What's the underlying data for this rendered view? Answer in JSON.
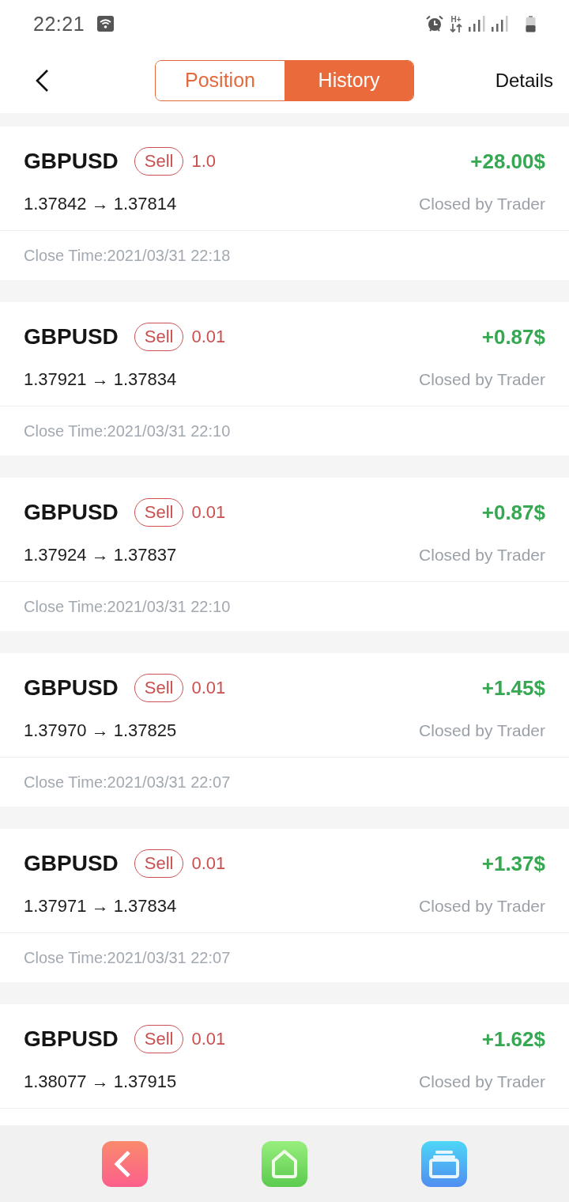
{
  "status_bar": {
    "time": "22:21",
    "network_type": "H+"
  },
  "header": {
    "tabs": [
      {
        "label": "Position",
        "selected": false
      },
      {
        "label": "History",
        "selected": true
      }
    ],
    "details": "Details"
  },
  "trades": [
    {
      "symbol": "GBPUSD",
      "side": "Sell",
      "volume": "1.0",
      "profit": "+28.00$",
      "prices": "1.37842 → 1.37814",
      "closed_by": "Closed by Trader",
      "close_time": "Close Time:2021/03/31 22:18"
    },
    {
      "symbol": "GBPUSD",
      "side": "Sell",
      "volume": "0.01",
      "profit": "+0.87$",
      "prices": "1.37921 → 1.37834",
      "closed_by": "Closed by Trader",
      "close_time": "Close Time:2021/03/31 22:10"
    },
    {
      "symbol": "GBPUSD",
      "side": "Sell",
      "volume": "0.01",
      "profit": "+0.87$",
      "prices": "1.37924 → 1.37837",
      "closed_by": "Closed by Trader",
      "close_time": "Close Time:2021/03/31 22:10"
    },
    {
      "symbol": "GBPUSD",
      "side": "Sell",
      "volume": "0.01",
      "profit": "+1.45$",
      "prices": "1.37970 → 1.37825",
      "closed_by": "Closed by Trader",
      "close_time": "Close Time:2021/03/31 22:07"
    },
    {
      "symbol": "GBPUSD",
      "side": "Sell",
      "volume": "0.01",
      "profit": "+1.37$",
      "prices": "1.37971 → 1.37834",
      "closed_by": "Closed by Trader",
      "close_time": "Close Time:2021/03/31 22:07"
    },
    {
      "symbol": "GBPUSD",
      "side": "Sell",
      "volume": "0.01",
      "profit": "+1.62$",
      "prices": "1.38077 → 1.37915",
      "closed_by": "Closed by Trader"
    }
  ]
}
